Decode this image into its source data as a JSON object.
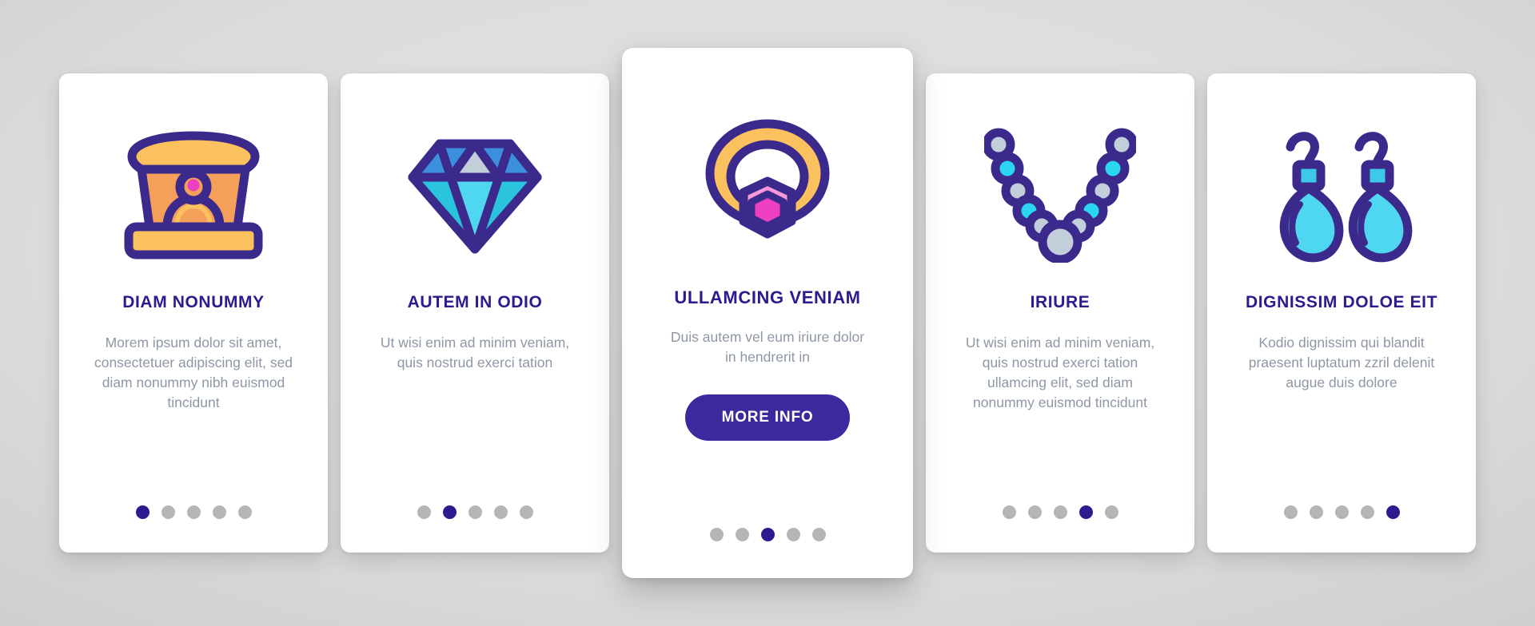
{
  "theme": {
    "accent": "#2E1A8F",
    "button_bg": "#3B2A9E",
    "title_color": "#2E1A8F",
    "body_text_color": "#8e97a6",
    "dot_inactive": "#b6b6b6",
    "card_bg": "#ffffff",
    "page_bg": "#d2d2d2",
    "icon_outline": "#3B2A8C",
    "icon_gold": "#FBC15E",
    "icon_orange": "#F5A05A",
    "icon_pink": "#EE3FC0",
    "icon_pink_light": "#F49AD8",
    "icon_blue": "#3B8FDD",
    "icon_cyan": "#4FD6F0",
    "icon_cyan_dark": "#2BC4DD",
    "icon_grey": "#C3CEDB"
  },
  "cards": [
    {
      "icon_name": "ring-box-icon",
      "title": "DIAM NONUMMY",
      "description": "Morem ipsum dolor sit amet, consectetuer adipiscing elit, sed diam nonummy nibh euismod tincidunt",
      "dots_total": 5,
      "dot_active_index": 0,
      "featured": false,
      "button_label": null
    },
    {
      "icon_name": "diamond-icon",
      "title": "AUTEM IN ODIO",
      "description": "Ut wisi enim ad minim veniam, quis nostrud exerci tation",
      "dots_total": 5,
      "dot_active_index": 1,
      "featured": false,
      "button_label": null
    },
    {
      "icon_name": "gemstone-ring-icon",
      "title": "ULLAMCING VENIAM",
      "description": "Duis autem vel eum iriure dolor in hendrerit in",
      "dots_total": 5,
      "dot_active_index": 2,
      "featured": true,
      "button_label": "MORE INFO"
    },
    {
      "icon_name": "pearl-necklace-icon",
      "title": "IRIURE",
      "description": "Ut wisi enim ad minim veniam, quis nostrud exerci tation ullamcing elit, sed diam nonummy euismod tincidunt",
      "dots_total": 5,
      "dot_active_index": 3,
      "featured": false,
      "button_label": null
    },
    {
      "icon_name": "earrings-icon",
      "title": "DIGNISSIM DOLOE EIT",
      "description": "Kodio dignissim qui blandit praesent luptatum zzril delenit augue duis dolore",
      "dots_total": 5,
      "dot_active_index": 4,
      "featured": false,
      "button_label": null
    }
  ]
}
